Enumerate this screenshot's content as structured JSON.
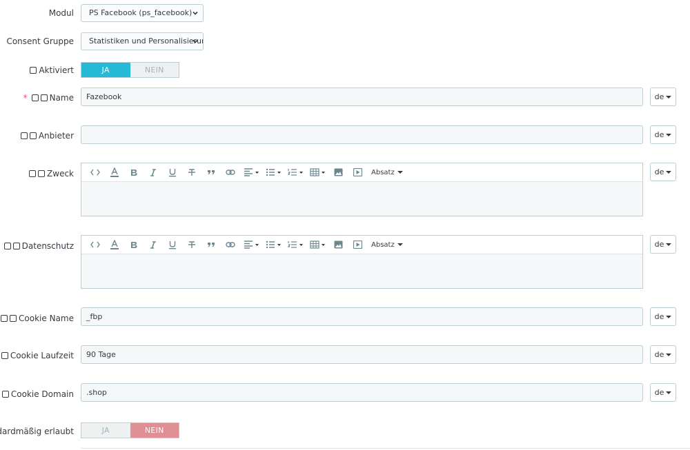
{
  "fields": {
    "modul": {
      "label": "Modul",
      "value": "PS Facebook (ps_facebook)"
    },
    "consent_gruppe": {
      "label": "Consent Gruppe",
      "value": "Statistiken und Personalisierung"
    },
    "aktiviert": {
      "label": "Aktiviert",
      "yes": "JA",
      "no": "NEIN",
      "selected": "JA"
    },
    "name": {
      "required_mark": "*",
      "label": "Name",
      "value": "Fazebook",
      "lang": "de"
    },
    "anbieter": {
      "label": "Anbieter",
      "value": "",
      "lang": "de"
    },
    "zweck": {
      "label": "Zweck",
      "lang": "de"
    },
    "datenschutz": {
      "label": "Datenschutz",
      "lang": "de"
    },
    "cookie_name": {
      "label": "Cookie Name",
      "value": "_fbp",
      "lang": "de"
    },
    "cookie_laufzeit": {
      "label": "Cookie Laufzeit",
      "value": "90 Tage",
      "lang": "de"
    },
    "cookie_domain": {
      "label": "Cookie Domain",
      "value": ".shop",
      "lang": "de"
    },
    "standard": {
      "label": "Standardmäßig erlaubt",
      "yes": "JA",
      "no": "NEIN",
      "selected": "NEIN"
    }
  },
  "editor_toolbar": {
    "format_label": "Absatz",
    "icons": [
      "code-icon",
      "text-color-icon",
      "bold-icon",
      "italic-icon",
      "underline-icon",
      "strikethrough-icon",
      "blockquote-icon",
      "link-icon",
      "align-icon",
      "bullet-list-icon",
      "numbered-list-icon",
      "table-icon",
      "image-icon",
      "video-icon"
    ]
  },
  "colors": {
    "accent": "#25b9d7",
    "danger": "#e08f95",
    "required": "#e84e6a",
    "border": "#bbcdd2"
  }
}
